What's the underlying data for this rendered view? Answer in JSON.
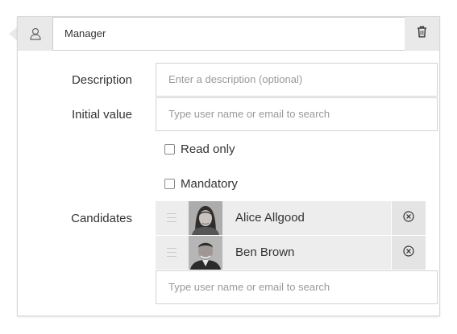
{
  "header": {
    "role_icon": "user-icon",
    "name_value": "Manager",
    "delete_icon": "trash-icon"
  },
  "form": {
    "description_label": "Description",
    "description_placeholder": "Enter a description (optional)",
    "initial_value_label": "Initial value",
    "initial_value_placeholder": "Type user name or email to search",
    "read_only_label": "Read only",
    "read_only_checked": false,
    "mandatory_label": "Mandatory",
    "mandatory_checked": false,
    "candidates_label": "Candidates",
    "candidates": [
      {
        "name": "Alice Allgood",
        "avatar": "female-avatar",
        "remove_icon": "remove-circle-icon"
      },
      {
        "name": "Ben Brown",
        "avatar": "male-avatar",
        "remove_icon": "remove-circle-icon"
      }
    ],
    "candidate_search_placeholder": "Type user name or email to search"
  }
}
